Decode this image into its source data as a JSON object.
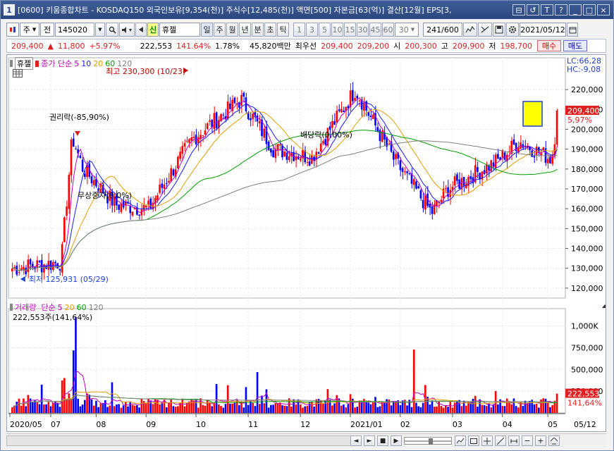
{
  "window": {
    "badge": "1",
    "title": "[0600] 키움종합차트 - KOSDAQ150 외국인보유[9,354(천)] 주식수[12,485(천)] 액면[500] 자본금[63(억)] 결산[12월] EPS[3,",
    "buttons": [
      "⊟",
      "↺",
      "T",
      "?",
      "_",
      "□",
      "×"
    ]
  },
  "toolbar": {
    "type_value": "주",
    "sel_value": "전",
    "code_value": "145020",
    "name_badge": "신",
    "stock_name": "휴젤",
    "periods": [
      "일",
      "주",
      "월",
      "년",
      "분",
      "초",
      "틱"
    ],
    "period_active": "일",
    "numbers": [
      "1",
      "3",
      "5",
      "10",
      "15",
      "30",
      "45",
      "60"
    ],
    "custom_value": "30",
    "count_value": "241/600",
    "date_value": "2021/05/12"
  },
  "pricebar": {
    "price": "209,400",
    "arrow": "▲",
    "change": "11,800",
    "change_pct": "+5.97%",
    "volume": "222,553",
    "volume_pct": "141.64%",
    "turnover": "1.78%",
    "amount_label": "45,820백만",
    "preferred": "최우선",
    "bid1": "209,400",
    "bid2": "209,200",
    "open_label": "시",
    "open": "200,300",
    "high_label": "고",
    "high": "209,900",
    "low_label": "저",
    "low": "198,700",
    "buy_button": "매수",
    "sell_button": "매도"
  },
  "price_panel": {
    "stock_tab": "휴젤",
    "ma_title": "종가 단순",
    "ma_periods": [
      {
        "label": "5",
        "color": "#c000c0"
      },
      {
        "label": "10",
        "color": "#1a1aff"
      },
      {
        "label": "20",
        "color": "#e6a000"
      },
      {
        "label": "60",
        "color": "#00a000"
      },
      {
        "label": "120",
        "color": "#808080"
      }
    ],
    "lc": "LC:66,28",
    "hc": "HC:-9,08",
    "current_price": "209,400",
    "current_pct": "5,97%",
    "y_labels": [
      "220,000",
      "210,000",
      "200,000",
      "190,000",
      "180,000",
      "170,000",
      "160,000",
      "150,000",
      "140,000",
      "130,000",
      "120,000"
    ],
    "y_values": [
      220000,
      210000,
      200000,
      190000,
      180000,
      170000,
      160000,
      150000,
      140000,
      130000,
      120000
    ],
    "high_note": "최고 230,300 (10/23)",
    "low_note": "최저 125,931 (05/29)",
    "annotations": [
      "권리락(-85,90%)",
      "무상증자(0,0%)",
      "배당락(0,00%)"
    ]
  },
  "volume_panel": {
    "title": "거래량",
    "ma_title": "단순",
    "ma_periods": [
      {
        "label": "5",
        "color": "#c000c0"
      },
      {
        "label": "20",
        "color": "#e6a000"
      },
      {
        "label": "60",
        "color": "#00a000"
      },
      {
        "label": "120",
        "color": "#808080"
      }
    ],
    "summary": "222,553주(141,64%)",
    "y_labels": [
      "1,000K",
      "750,000",
      "500,000",
      "250,000"
    ],
    "y_values": [
      1000000,
      750000,
      500000,
      250000
    ],
    "current_volume": "222,553",
    "current_pct": "141,64%"
  },
  "x_axis": {
    "labels": [
      "2020/05",
      "07",
      "08",
      "09",
      "10",
      "11",
      "12",
      "2021/01",
      "02",
      "03",
      "04",
      "05"
    ],
    "end_label": "05/12"
  },
  "scrollbar": {
    "controls": [
      "◄",
      "►",
      "■",
      "▶"
    ],
    "zoom_minus": "−",
    "zoom_plus": "+"
  },
  "chart_data": {
    "type": "candlestick",
    "price_range": [
      115000,
      236000
    ],
    "volume_range": [
      0,
      1200000
    ],
    "anchors_x": [
      0.0,
      0.09,
      0.11,
      0.13,
      0.19,
      0.25,
      0.33,
      0.42,
      0.48,
      0.55,
      0.63,
      0.7,
      0.77,
      0.8,
      0.89,
      0.93,
      0.99,
      1.0
    ],
    "anchors_p": [
      130000,
      133000,
      196000,
      180000,
      162000,
      160000,
      195000,
      215000,
      190000,
      186000,
      220000,
      185000,
      158000,
      170000,
      184000,
      194000,
      185000,
      205000
    ]
  }
}
